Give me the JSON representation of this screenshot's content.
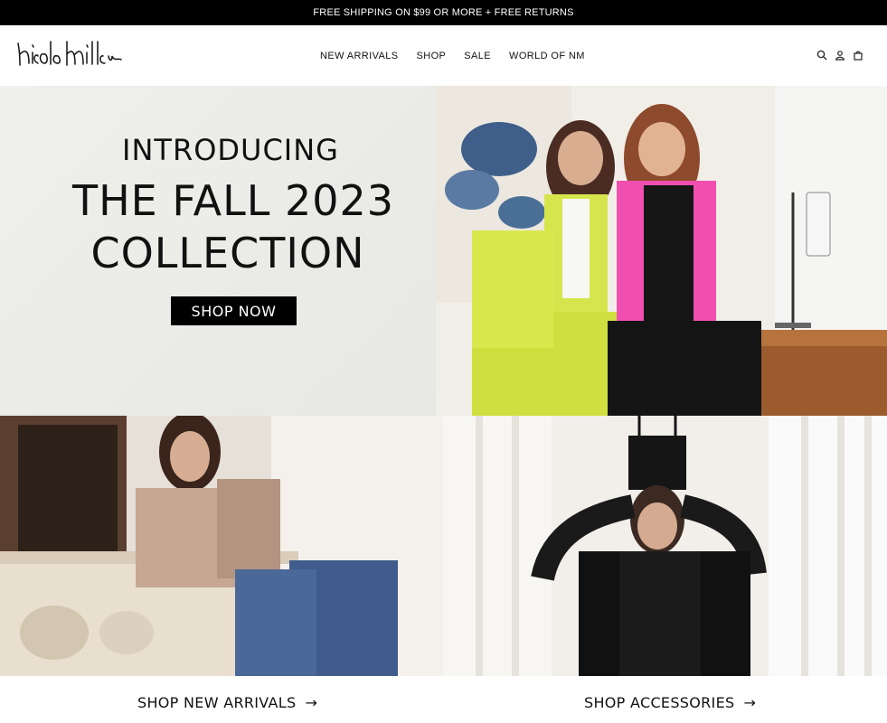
{
  "promo": {
    "text": "FREE SHIPPING ON $99 OR MORE + FREE RETURNS"
  },
  "header": {
    "logo_text": "Nicole Miller",
    "nav": [
      {
        "label": "NEW ARRIVALS"
      },
      {
        "label": "SHOP"
      },
      {
        "label": "SALE"
      },
      {
        "label": "WORLD OF NM"
      }
    ],
    "icons": [
      "search-icon",
      "account-icon",
      "bag-icon"
    ]
  },
  "hero": {
    "line1": "INTRODUCING",
    "line2": "THE FALL 2023",
    "line3": "COLLECTION",
    "button": "SHOP NOW"
  },
  "ctas": [
    {
      "label": "SHOP NEW ARRIVALS",
      "arrow": "→"
    },
    {
      "label": "SHOP ACCESSORIES",
      "arrow": "→"
    }
  ]
}
